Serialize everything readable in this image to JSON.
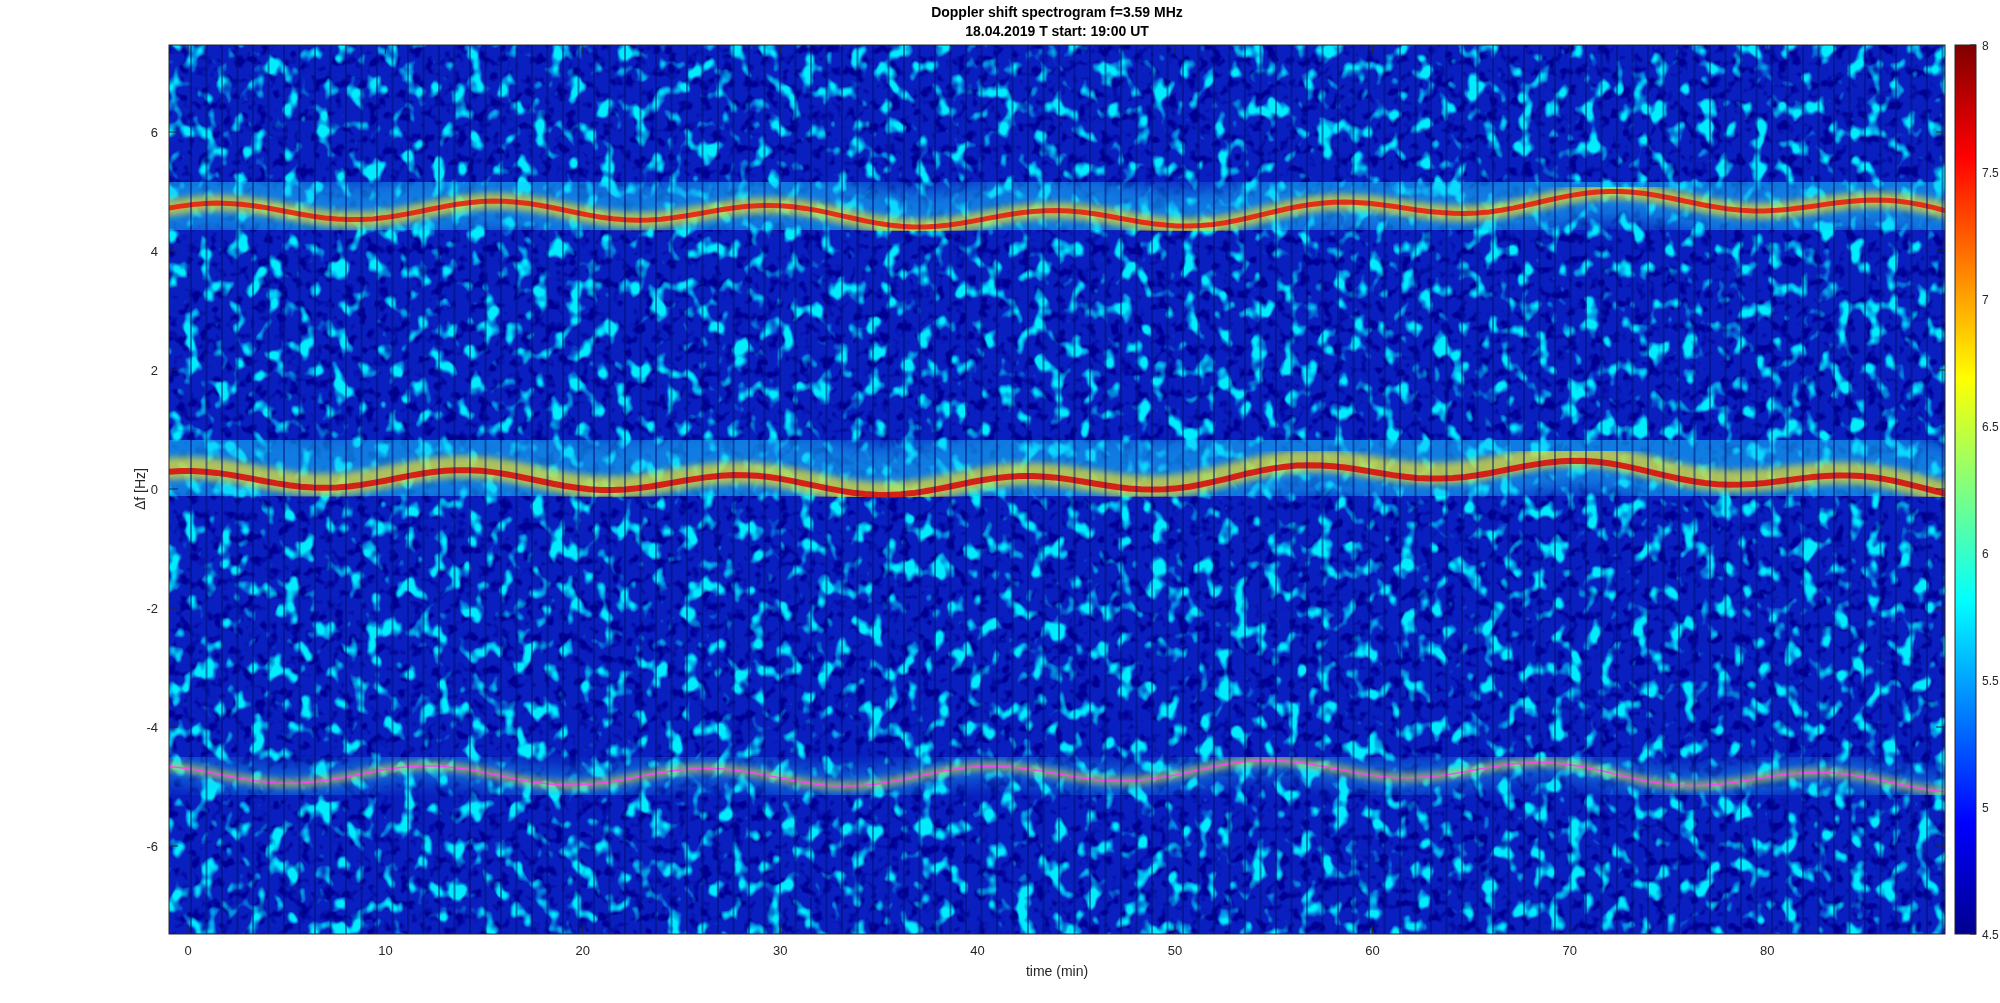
{
  "title": [
    "Doppler shift spectrogram f=3.59 MHz",
    "18.04.2019    T start: 19:00 UT"
  ],
  "x_axis": {
    "label": "time (min)",
    "ticks": [
      "0",
      "10",
      "20",
      "30",
      "40",
      "50",
      "60",
      "70",
      "80"
    ]
  },
  "y_axis": {
    "label": "Δf [Hz]",
    "ticks": [
      "6",
      "4",
      "2",
      "0",
      "-2",
      "-4",
      "-6"
    ]
  },
  "colorbar": {
    "ticks": [
      "8",
      "7.5",
      "7",
      "6.5",
      "6",
      "5.5",
      "5",
      "4.5"
    ]
  }
}
